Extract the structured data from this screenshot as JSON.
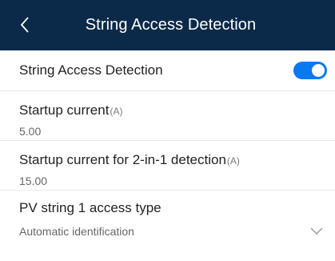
{
  "header": {
    "title": "String Access Detection",
    "back_icon": "chevron-left-icon"
  },
  "toggle_row": {
    "label": "String Access Detection",
    "enabled": true,
    "accent_color": "#0a78f0"
  },
  "fields": [
    {
      "label": "Startup current",
      "unit": "(A)",
      "value": "5.00"
    },
    {
      "label": "Startup current for 2-in-1 detection",
      "unit": "(A)",
      "value": "15.00"
    }
  ],
  "pv_string": {
    "label": "PV string 1 access type",
    "selected": "Automatic identification",
    "icon": "chevron-down-icon"
  },
  "colors": {
    "header_bg": "#0b2a49",
    "text": "#222222",
    "secondary": "#666666"
  }
}
